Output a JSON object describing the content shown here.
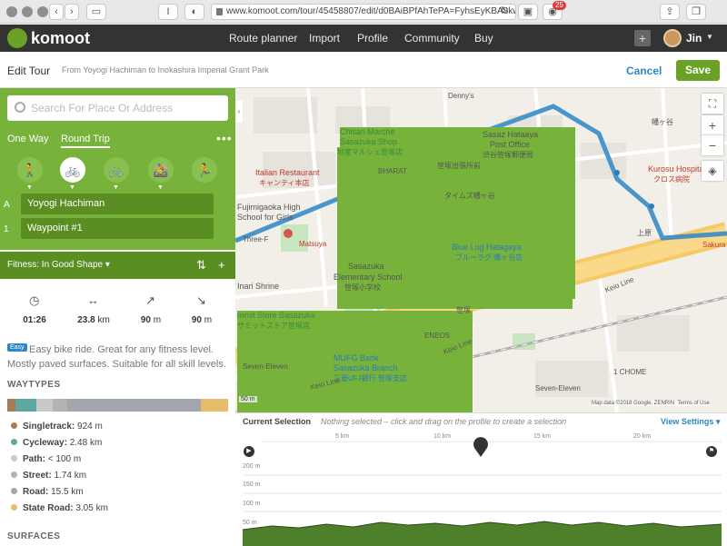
{
  "browser": {
    "url": "www.komoot.com/tour/45458807/edit/d0BAiBPfAhTePA=FyhsEyKBA8kw",
    "ext_badge": "25",
    "reader_glyph": "I"
  },
  "nav": {
    "brand": "komoot",
    "links": [
      "Route planner",
      "Import",
      "Profile",
      "Community",
      "Buy"
    ],
    "user": "Jin",
    "add_glyph": "+"
  },
  "editbar": {
    "title": "Edit Tour",
    "subtitle": "From Yoyogi Hachiman to Inokashira Imperial Grant Park",
    "cancel": "Cancel",
    "save": "Save"
  },
  "planner": {
    "search_placeholder": "Search For Place Or Address",
    "tabs": [
      "One Way",
      "Round Trip"
    ],
    "active_tab": "Round Trip",
    "more": "•••",
    "sports": [
      "hiking",
      "touring bike",
      "road bike",
      "mountain bike",
      "running"
    ],
    "selected_sport": "touring bike",
    "waypoints": [
      {
        "index": "A",
        "name": "Yoyogi Hachiman"
      },
      {
        "index": "1",
        "name": "Waypoint #1"
      }
    ],
    "fitness": "Fitness: In Good Shape ▾"
  },
  "stats": {
    "duration": "01:26",
    "distance": "23.8",
    "distance_unit": "km",
    "uphill": "90",
    "uphill_unit": "m",
    "downhill": "90",
    "downhill_unit": "m"
  },
  "difficulty": {
    "badge": "Easy",
    "text": "Easy bike ride. Great for any fitness level. Mostly paved surfaces. Suitable for all skill levels."
  },
  "waytypes": {
    "title": "WAYTYPES",
    "bar_colors": [
      "#a57c56",
      "#5fa8a1",
      "#c9c9c9",
      "#b3b3b3",
      "#a3a6ad",
      "#e6be6a"
    ],
    "bar_fractions": [
      0.04,
      0.1,
      0.08,
      0.07,
      0.65,
      0.13
    ],
    "items": [
      {
        "label": "Singletrack:",
        "value": "924 m",
        "color": "#a57c56"
      },
      {
        "label": "Cycleway:",
        "value": "2.48 km",
        "color": "#5fa8a1"
      },
      {
        "label": "Path:",
        "value": "< 100 m",
        "color": "#c9c9c9"
      },
      {
        "label": "Street:",
        "value": "1.74 km",
        "color": "#b3b3b3"
      },
      {
        "label": "Road:",
        "value": "15.5 km",
        "color": "#a3a6ad"
      },
      {
        "label": "State Road:",
        "value": "3.05 km",
        "color": "#e6be6a"
      }
    ],
    "surfaces_title": "SURFACES"
  },
  "map": {
    "labels": {
      "dennys": "Denny's",
      "chisan": "Chisan Marche",
      "chisan2": "Sasazuka Shop",
      "chisan_jp": "地産マルシェ笹塚店",
      "sasaz_post": "Sasaz Hataaya",
      "post_office": "Post Office",
      "post_jp": "渋谷笹塚郵便局",
      "italian": "Italian Restaurant",
      "italian_jp": "キャンティ本店",
      "bharat": "BHARAT",
      "station": "笹塚出張所前",
      "fujimigaoka": "Fujimigaoka High",
      "fujimigaoka2": "School for Girls",
      "kurosu": "Kurosu Hospital",
      "kurosu_jp": "クロス病院",
      "blue_lug": "Blue Lug Hatagaya",
      "blue_lug_jp": "ブルーラグ 幡ヶ谷店",
      "matsuya": "Matsuya",
      "sasazuka_es": "Sasazuka",
      "sasazuka_es2": "Elementary School",
      "sasazuka_es_jp": "笹塚小学校",
      "inari": "Inari Shrine",
      "summit": "mmit Store Sasazuka",
      "summit_jp": "サミットストア笹塚店",
      "sasazuka": "笹塚",
      "eneos": "ENEOS",
      "mufg": "MUFG Bank",
      "mufg2": "Sasazuka Branch",
      "mufg_jp": "三菱UFJ銀行 笹塚支店",
      "seven1": "Seven-Eleven",
      "seven2": "Seven-Eleven",
      "keio1": "Keio Line",
      "keio2": "Keio Line",
      "keio3": "Keio Line",
      "hatagaya": "幡ヶ谷",
      "chome": "1 CHOME",
      "uehara": "上原",
      "sakura": "Sakura",
      "scale": "50 m",
      "attribution": "Map data ©2018 Google, ZENRIN",
      "terms": "Terms of Use",
      "taimuzu": "タイムズ幡ヶ谷",
      "three_f": "Three-F"
    },
    "controls": {
      "zoom_in": "+",
      "zoom_out": "−",
      "layers": "◈",
      "fullscreen": "⛶"
    }
  },
  "profile": {
    "current_selection": "Current Selection",
    "hint": "Nothing selected – click and drag on the profile to create a selection",
    "view_settings": "View Settings ▾",
    "km_ticks": [
      "5 km",
      "10 km",
      "15 km",
      "20 km"
    ],
    "elevation_ticks": [
      "200 m",
      "150 m",
      "100 m",
      "50 m"
    ]
  }
}
